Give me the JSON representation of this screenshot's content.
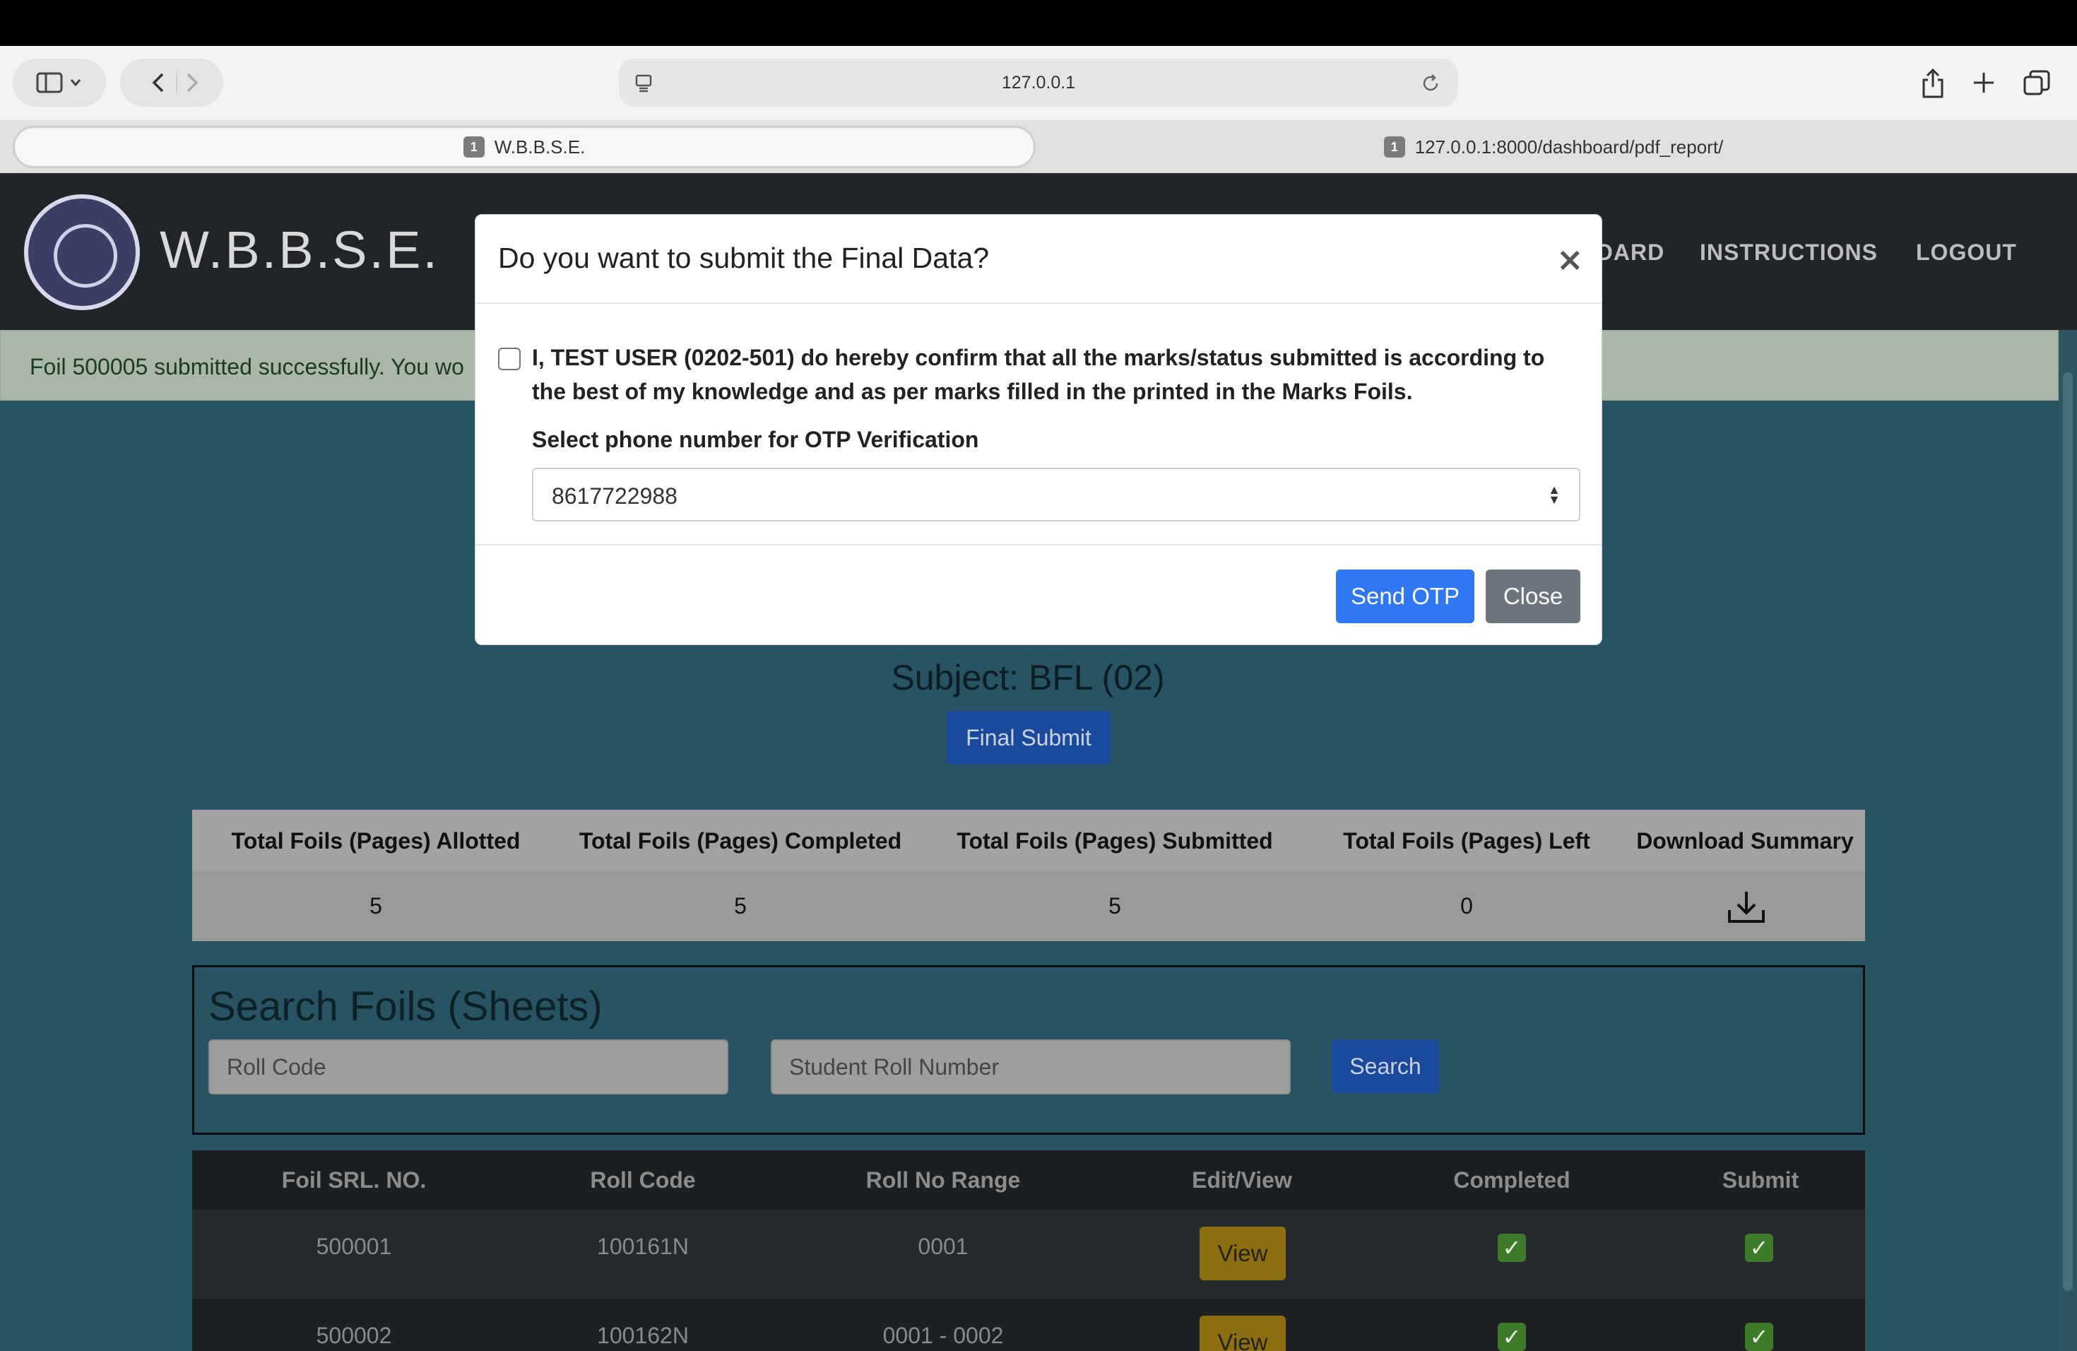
{
  "browser": {
    "address": "127.0.0.1",
    "tabs": [
      {
        "num": "1",
        "label": "W.B.B.S.E."
      },
      {
        "num": "1",
        "label": "127.0.0.1:8000/dashboard/pdf_report/"
      }
    ]
  },
  "navbar": {
    "brand": "W.B.B.S.E.",
    "links": [
      "DASHBOARD",
      "INSTRUCTIONS",
      "LOGOUT"
    ],
    "link_partial_visible": "OARD"
  },
  "alert": {
    "text": "Foil 500005 submitted successfully. You wo"
  },
  "modal": {
    "title": "Do you want to submit the Final Data?",
    "close_icon": "×",
    "confirm_text": "I, TEST USER (0202-501) do hereby confirm that all the marks/status submitted is according to the best of my knowledge and as per marks filled in the printed in the Marks Foils.",
    "otp_label": "Select phone number for OTP Verification",
    "phone_selected": "8617722988",
    "send_otp_label": "Send OTP",
    "close_label": "Close"
  },
  "subject": {
    "text": "Subject: BFL (02)",
    "final_submit_label": "Final Submit"
  },
  "stats": {
    "headers": [
      "Total Foils (Pages) Allotted",
      "Total Foils (Pages) Completed",
      "Total Foils (Pages) Submitted",
      "Total Foils (Pages) Left",
      "Download Summary"
    ],
    "values": [
      "5",
      "5",
      "5",
      "0"
    ],
    "download_icon": "download-icon"
  },
  "search": {
    "title": "Search Foils (Sheets)",
    "roll_code_placeholder": "Roll Code",
    "student_roll_placeholder": "Student Roll Number",
    "button_label": "Search"
  },
  "table": {
    "headers": [
      "Foil SRL. NO.",
      "Roll Code",
      "Roll No Range",
      "Edit/View",
      "Completed",
      "Submit"
    ],
    "rows": [
      {
        "foil": "500001",
        "roll_code": "100161N",
        "range": "0001",
        "action": "View",
        "completed": "✓",
        "submit": "✓"
      },
      {
        "foil": "500002",
        "roll_code": "100162N",
        "range": "0001 - 0002",
        "action": "View",
        "completed": "✓",
        "submit": "✓"
      }
    ]
  },
  "colors": {
    "page_bg": "#275362",
    "navbar_bg": "#212529",
    "primary": "#2f78f2",
    "secondary": "#6c757d",
    "warning": "#8c6e10",
    "success": "#3d7a2a"
  }
}
